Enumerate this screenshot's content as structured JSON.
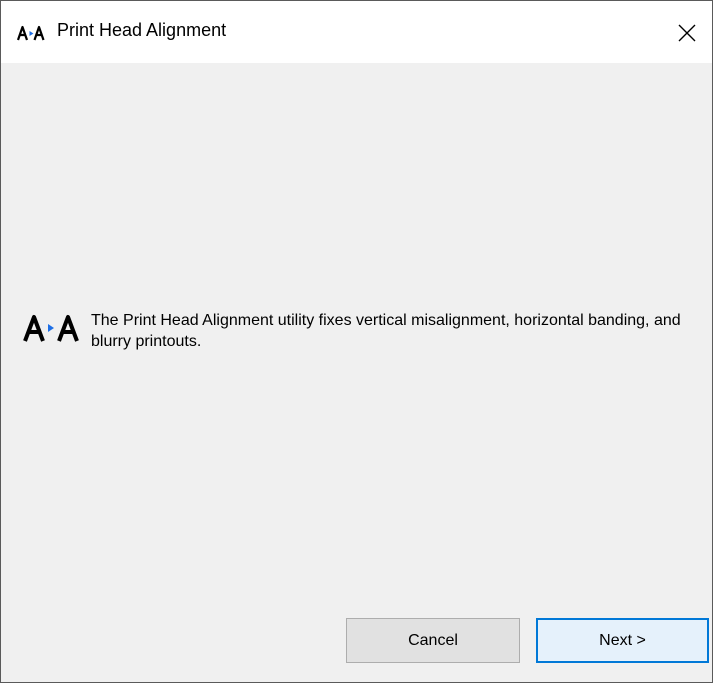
{
  "window": {
    "title": "Print Head Alignment",
    "icon": "print-head-alignment-icon",
    "close_icon": "close-icon"
  },
  "content": {
    "icon": "print-head-alignment-icon",
    "message": "The Print Head Alignment utility fixes vertical misalignment, horizontal banding, and blurry printouts."
  },
  "buttons": {
    "cancel_label": "Cancel",
    "next_label": "Next >"
  },
  "colors": {
    "window_bg": "#f0f0f0",
    "titlebar_bg": "#ffffff",
    "accent_border": "#0078d7",
    "icon_arrow": "#1e6fe6"
  }
}
